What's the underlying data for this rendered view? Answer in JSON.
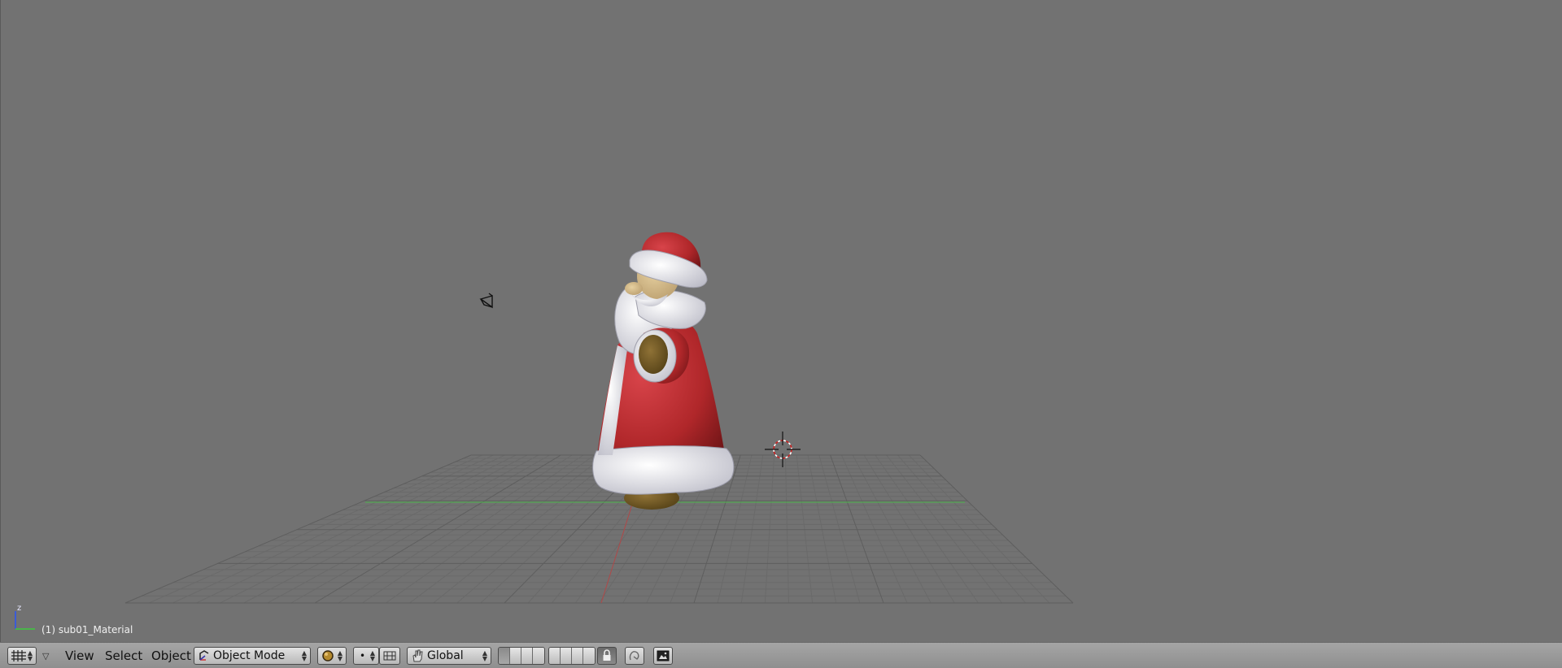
{
  "viewport": {
    "object_info": "(1) sub01_Material",
    "axis": {
      "z_label": "z"
    }
  },
  "header": {
    "editor_type_icon": "viewport-grid-icon",
    "menus": {
      "view": "View",
      "select": "Select",
      "object": "Object"
    },
    "mode": {
      "icon": "object-mode-icon",
      "value": "Object Mode"
    },
    "shading_icon": "shading-solid-icon",
    "pivot": {
      "icon": "pivot-point-icon",
      "value": "•"
    },
    "manipulator_icon": "manipulator-icon",
    "transform_orientation": {
      "icon": "hand-icon",
      "value": "Global"
    },
    "lock_icon": "lock-icon",
    "ghost_icon": "ghost-icon",
    "render_icon": "render-icon"
  },
  "colors": {
    "background": "#727272",
    "header": "#999999",
    "grid": "#6a6a6a",
    "x_axis": "#cc4444",
    "y_axis": "#44bb44",
    "suit_red": "#b0272a",
    "fur_white": "#e8e8ec",
    "boot_brown": "#6b5320"
  }
}
